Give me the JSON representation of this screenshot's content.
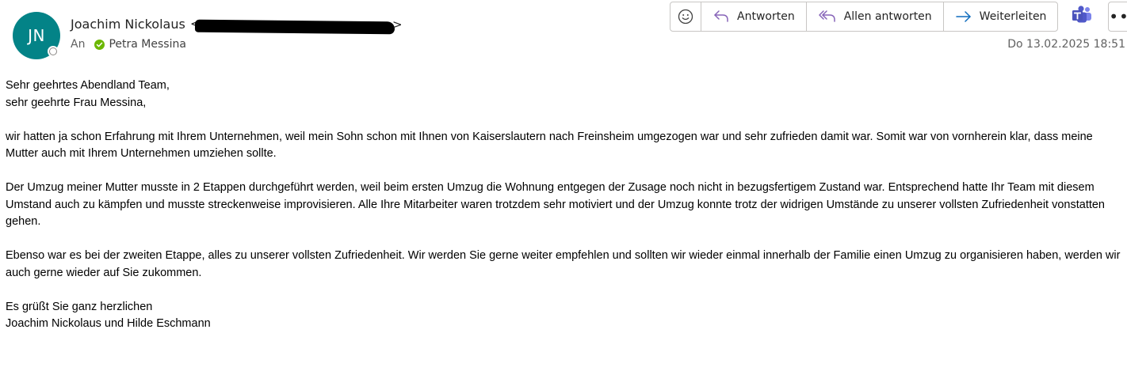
{
  "sender": {
    "initials": "JN",
    "name": "Joachim Nickolaus",
    "avatar_color": "#038387"
  },
  "to": {
    "label": "An",
    "recipient": "Petra Messina",
    "status_color": "#6bb700"
  },
  "actions": {
    "emoji_icon": "smiley-icon",
    "reply_label": "Antworten",
    "reply_all_label": "Allen antworten",
    "forward_label": "Weiterleiten",
    "teams_icon": "teams-icon",
    "more_label": "•••",
    "accent_color": "#8764b8",
    "forward_color": "#0f6cbd"
  },
  "date": "Do 13.02.2025 18:51",
  "body": {
    "greeting_1": "Sehr geehrtes Abendland Team,",
    "greeting_2": "sehr geehrte Frau Messina,",
    "paragraph_1": "wir hatten ja schon Erfahrung mit Ihrem Unternehmen, weil mein Sohn schon mit Ihnen von Kaiserslautern nach Freinsheim umgezogen war und sehr zufrieden damit war. Somit war von vornherein klar, dass meine Mutter auch mit Ihrem Unternehmen umziehen sollte.",
    "paragraph_2": "Der Umzug meiner Mutter musste in 2 Etappen durchgeführt werden, weil beim ersten Umzug die Wohnung entgegen der Zusage noch nicht in bezugsfertigem Zustand war. Entsprechend hatte Ihr Team mit diesem Umstand auch zu kämpfen und musste streckenweise improvisieren. Alle Ihre Mitarbeiter waren trotzdem sehr motiviert und der Umzug konnte trotz der widrigen Umstände zu unserer vollsten Zufriedenheit vonstatten gehen.",
    "paragraph_3": "Ebenso war es bei der zweiten Etappe, alles zu unserer vollsten Zufriedenheit. Wir werden Sie gerne weiter empfehlen und sollten wir wieder einmal innerhalb der Familie einen Umzug zu organisieren haben, werden wir auch gerne wieder auf Sie zukommen.",
    "closing_1": "Es grüßt Sie ganz herzlichen",
    "closing_2": "Joachim Nickolaus und Hilde Eschmann"
  }
}
